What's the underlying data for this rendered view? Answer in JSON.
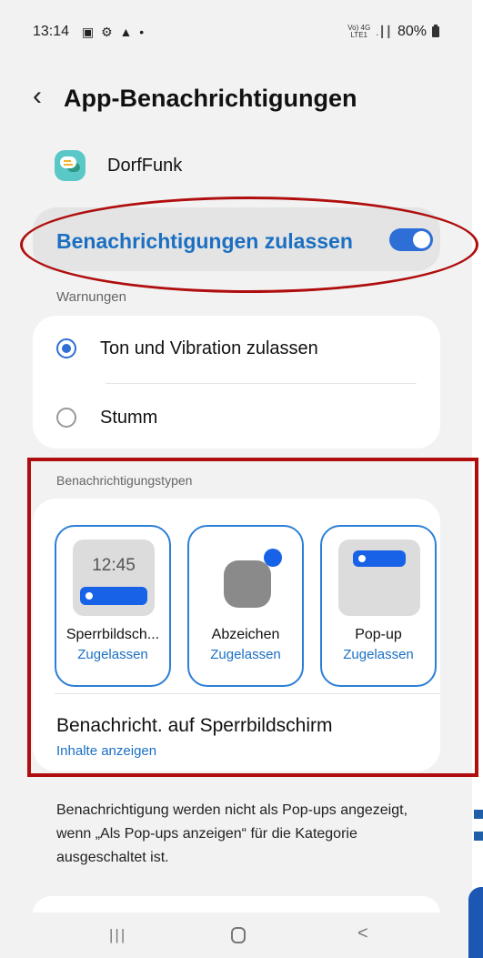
{
  "status_bar": {
    "time": "13:14",
    "left_icons": "▣ ⚙ ▲ •",
    "network": "Vo) 4G",
    "network_sub": "LTE1",
    "signal": ".┃┃",
    "battery": "80%"
  },
  "header": {
    "back_glyph": "‹",
    "title": "App-Benachrichtigungen"
  },
  "app": {
    "name": "DorfFunk"
  },
  "allow": {
    "label": "Benachrichtigungen zulassen",
    "enabled": true
  },
  "warnings": {
    "section_label": "Warnungen",
    "options": [
      {
        "label": "Ton und Vibration zulassen",
        "selected": true
      },
      {
        "label": "Stumm",
        "selected": false
      }
    ]
  },
  "types": {
    "section_label": "Benachrichtigungstypen",
    "tiles": [
      {
        "name": "Sperrbildsch...",
        "status": "Zugelassen",
        "preview_time": "12:45"
      },
      {
        "name": "Abzeichen",
        "status": "Zugelassen"
      },
      {
        "name": "Pop-up",
        "status": "Zugelassen"
      }
    ],
    "lockscreen": {
      "title": "Benachricht. auf Sperrbildschirm",
      "value": "Inhalte anzeigen"
    }
  },
  "footnote": "Benachrichtigung werden nicht als Pop-ups angezeigt, wenn „Als Pop-ups anzeigen“ für die Kategorie ausgeschaltet ist.",
  "navbar": {
    "recents": "|||",
    "back": "<"
  },
  "colors": {
    "accent": "#1b6fc2",
    "toggle": "#2d6fd6",
    "annotation": "#b00e0e",
    "background": "#f2f2f2"
  }
}
